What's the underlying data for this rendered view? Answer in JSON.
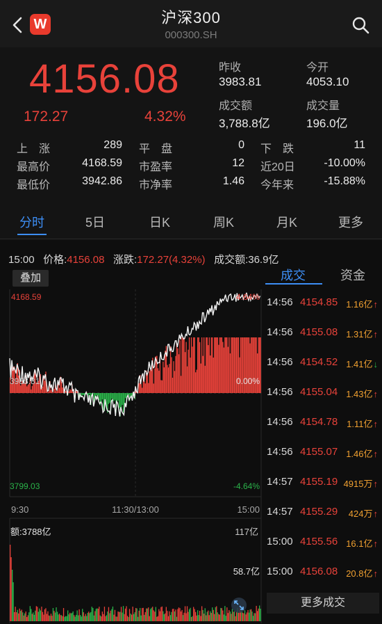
{
  "header": {
    "title": "沪深300",
    "code": "000300.SH",
    "logo": "W"
  },
  "quote": {
    "price": "4156.08",
    "change": "172.27",
    "change_pct": "4.32%",
    "prev_close_label": "昨收",
    "prev_close": "3983.81",
    "open_label": "今开",
    "open": "4053.10",
    "turnover_label": "成交额",
    "turnover": "3,788.8亿",
    "volume_label": "成交量",
    "volume": "196.0亿"
  },
  "stats": [
    [
      {
        "l": "上　涨",
        "v": "289"
      },
      {
        "l": "平　盘",
        "v": "0"
      },
      {
        "l": "下　跌",
        "v": "11"
      }
    ],
    [
      {
        "l": "最高价",
        "v": "4168.59"
      },
      {
        "l": "市盈率",
        "v": "12"
      },
      {
        "l": "近20日",
        "v": "-10.00%"
      }
    ],
    [
      {
        "l": "最低价",
        "v": "3942.86"
      },
      {
        "l": "市净率",
        "v": "1.46"
      },
      {
        "l": "今年来",
        "v": "-15.88%"
      }
    ]
  ],
  "tabs": [
    "分时",
    "5日",
    "日K",
    "周K",
    "月K",
    "更多"
  ],
  "info": {
    "time": "15:00",
    "price_label": "价格:",
    "price": "4156.08",
    "chg_label": "涨跌:",
    "chg": "172.27(4.32%)",
    "amt_label": "成交额:",
    "amt": "36.9亿"
  },
  "overlay_label": "叠加",
  "chart_labels": {
    "high": "4168.59",
    "mid": "3983.81",
    "low": "3799.03",
    "pct_high": "4.64%",
    "pct_mid": "0.00%",
    "pct_low": "-4.64%",
    "t_start": "9:30",
    "t_mid": "11:30/13:00",
    "t_end": "15:00",
    "amt": "额:3788亿",
    "v_high": "117亿",
    "v_mid": "58.7亿"
  },
  "right_tabs": [
    "成交",
    "资金"
  ],
  "trades": [
    {
      "time": "14:56",
      "price": "4154.85",
      "vol": "1.16亿",
      "dir": "up"
    },
    {
      "time": "14:56",
      "price": "4155.08",
      "vol": "1.31亿",
      "dir": "up"
    },
    {
      "time": "14:56",
      "price": "4154.52",
      "vol": "1.41亿",
      "dir": "down"
    },
    {
      "time": "14:56",
      "price": "4155.04",
      "vol": "1.43亿",
      "dir": "up"
    },
    {
      "time": "14:56",
      "price": "4154.78",
      "vol": "1.11亿",
      "dir": "up"
    },
    {
      "time": "14:56",
      "price": "4155.07",
      "vol": "1.46亿",
      "dir": "up"
    },
    {
      "time": "14:57",
      "price": "4155.19",
      "vol": "4915万",
      "dir": "up"
    },
    {
      "time": "14:57",
      "price": "4155.29",
      "vol": "424万",
      "dir": "up"
    },
    {
      "time": "15:00",
      "price": "4155.56",
      "vol": "16.1亿",
      "dir": "up"
    },
    {
      "time": "15:00",
      "price": "4156.08",
      "vol": "20.8亿",
      "dir": "up"
    }
  ],
  "more_trades_label": "更多成交",
  "colors": {
    "up": "#e8423a",
    "down": "#2bb34a",
    "accent": "#3d8ef5"
  }
}
